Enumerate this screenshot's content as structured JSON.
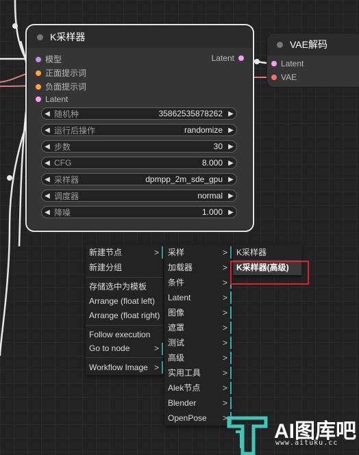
{
  "colors": {
    "slot_model": "#b39ddb",
    "slot_positive": "#ffa931",
    "slot_negative": "#ffa931",
    "slot_latent": "#ff9cf9",
    "slot_vae": "#ff6e6e",
    "menu_accent": "#2bb5b0",
    "highlight_box": "#d9252f"
  },
  "ksampler": {
    "title": "K采样器",
    "inputs": [
      "模型",
      "正面提示词",
      "负面提示词",
      "Latent"
    ],
    "output": "Latent",
    "widgets": [
      {
        "label": "随机种",
        "value": "35862535878262"
      },
      {
        "label": "运行后操作",
        "value": "randomize"
      },
      {
        "label": "步数",
        "value": "30"
      },
      {
        "label": "CFG",
        "value": "8.000"
      },
      {
        "label": "采样器",
        "value": "dpmpp_2m_sde_gpu"
      },
      {
        "label": "调度器",
        "value": "normal"
      },
      {
        "label": "降噪",
        "value": "1.000"
      }
    ]
  },
  "vae_decode": {
    "title": "VAE解码",
    "inputs": [
      "Latent",
      "VAE"
    ]
  },
  "context_menu": {
    "level1": [
      {
        "label": "新建节点",
        "chev": ">"
      },
      {
        "label": "新建分组"
      },
      {
        "label": "存储选中为模板"
      },
      {
        "label": "Arrange (float left)"
      },
      {
        "label": "Arrange (float right)"
      },
      {
        "label": "Follow execution"
      },
      {
        "label": "Go to node",
        "chev": ">"
      },
      {
        "label": "Workflow Image",
        "chev": ">"
      }
    ],
    "level2": [
      {
        "label": "采样",
        "chev": ">"
      },
      {
        "label": "加载器",
        "chev": ">"
      },
      {
        "label": "条件",
        "chev": ">"
      },
      {
        "label": "Latent",
        "chev": ">"
      },
      {
        "label": "图像",
        "chev": ">"
      },
      {
        "label": "遮罩",
        "chev": ">"
      },
      {
        "label": "测试",
        "chev": ">"
      },
      {
        "label": "高级",
        "chev": ">"
      },
      {
        "label": "实用工具",
        "chev": ">"
      },
      {
        "label": "Alek节点",
        "chev": ">"
      },
      {
        "label": "Blender",
        "chev": ">"
      },
      {
        "label": "OpenPose",
        "chev": ">"
      }
    ],
    "level3": [
      {
        "label": "K采样器"
      },
      {
        "label": "K采样器(高级)"
      }
    ]
  },
  "watermark": {
    "brand": "AI图库吧",
    "url": "www.aituku.cc"
  }
}
